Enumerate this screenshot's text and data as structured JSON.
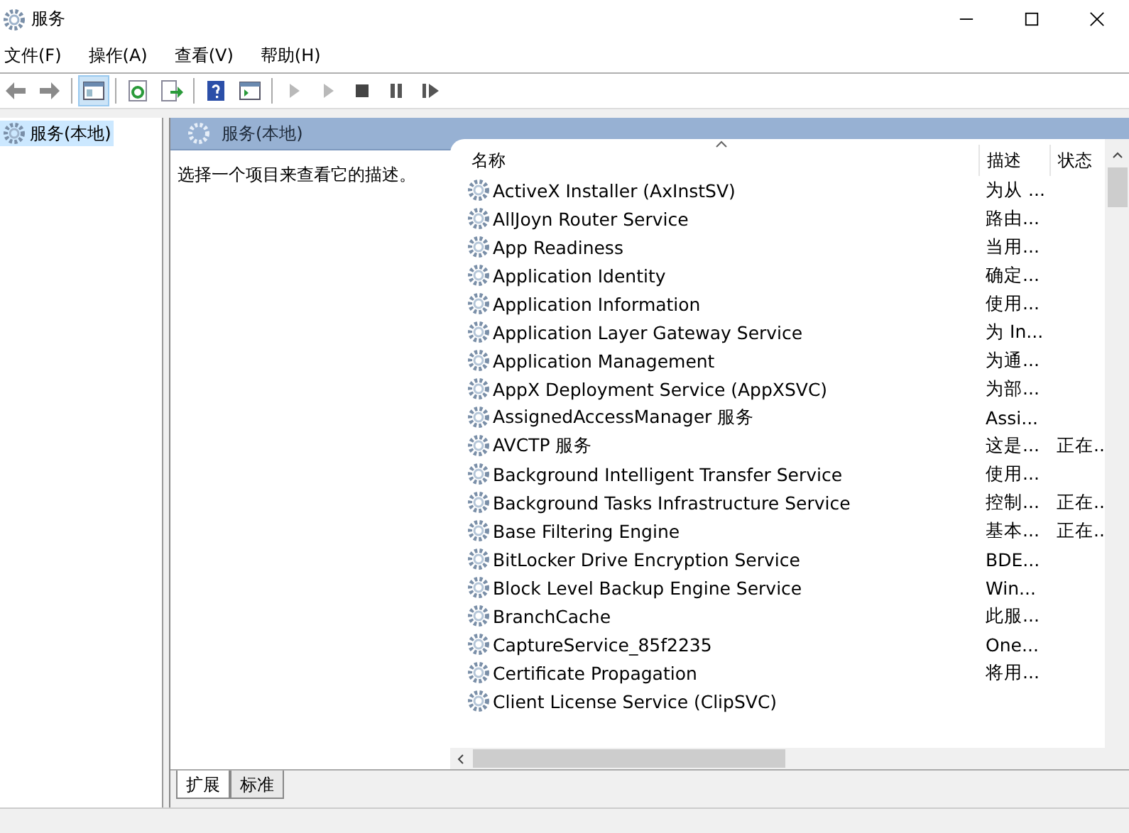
{
  "window": {
    "title": "服务"
  },
  "menu": [
    "文件(F)",
    "操作(A)",
    "查看(V)",
    "帮助(H)"
  ],
  "toolbar": [
    {
      "kind": "back",
      "pressed": false,
      "disabled": false
    },
    {
      "kind": "forward",
      "pressed": false,
      "disabled": false
    },
    {
      "kind": "sep"
    },
    {
      "kind": "tree",
      "pressed": true,
      "disabled": false
    },
    {
      "kind": "sep"
    },
    {
      "kind": "refresh",
      "pressed": false,
      "disabled": false
    },
    {
      "kind": "export",
      "pressed": false,
      "disabled": false
    },
    {
      "kind": "sep"
    },
    {
      "kind": "help",
      "pressed": false,
      "disabled": false
    },
    {
      "kind": "view",
      "pressed": false,
      "disabled": false
    },
    {
      "kind": "sep"
    },
    {
      "kind": "play",
      "pressed": false,
      "disabled": true
    },
    {
      "kind": "play",
      "pressed": false,
      "disabled": true
    },
    {
      "kind": "stop",
      "pressed": false,
      "disabled": false
    },
    {
      "kind": "pause",
      "pressed": false,
      "disabled": false
    },
    {
      "kind": "resume",
      "pressed": false,
      "disabled": false
    }
  ],
  "tree": [
    {
      "label": "服务(本地)",
      "selected": true
    }
  ],
  "panel": {
    "title": "服务(本地)",
    "hint": "选择一个项目来查看它的描述。"
  },
  "table": {
    "columns": [
      "名称",
      "描述",
      "状态"
    ],
    "rows": [
      {
        "name": "ActiveX Installer (AxInstSV)",
        "desc": "为从 ..."
      },
      {
        "name": "AllJoyn Router Service",
        "desc": "路由..."
      },
      {
        "name": "App Readiness",
        "desc": "当用..."
      },
      {
        "name": "Application Identity",
        "desc": "确定..."
      },
      {
        "name": "Application Information",
        "desc": "使用..."
      },
      {
        "name": "Application Layer Gateway Service",
        "desc": "为 In..."
      },
      {
        "name": "Application Management",
        "desc": "为通..."
      },
      {
        "name": "AppX Deployment Service (AppXSVC)",
        "desc": "为部..."
      },
      {
        "name": "AssignedAccessManager 服务",
        "desc": "Assi..."
      },
      {
        "name": "AVCTP 服务",
        "desc": "这是...",
        "status": "正在.."
      },
      {
        "name": "Background Intelligent Transfer Service",
        "desc": "使用..."
      },
      {
        "name": "Background Tasks Infrastructure Service",
        "desc": "控制...",
        "status": "正在.."
      },
      {
        "name": "Base Filtering Engine",
        "desc": "基本...",
        "status": "正在.."
      },
      {
        "name": "BitLocker Drive Encryption Service",
        "desc": "BDE..."
      },
      {
        "name": "Block Level Backup Engine Service",
        "desc": "Win..."
      },
      {
        "name": "BranchCache",
        "desc": "此服..."
      },
      {
        "name": "CaptureService_85f2235",
        "desc": "One..."
      },
      {
        "name": "Certificate Propagation",
        "desc": "将用..."
      },
      {
        "name": "Client License Service (ClipSVC)"
      }
    ]
  },
  "bottom_tabs": [
    {
      "label": "扩展",
      "selected": true
    },
    {
      "label": "标准",
      "selected": false
    }
  ]
}
